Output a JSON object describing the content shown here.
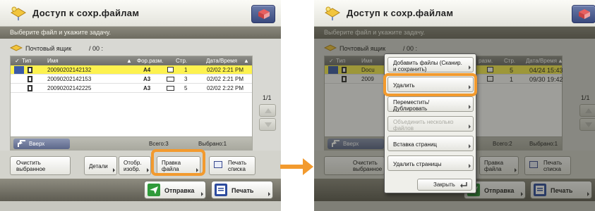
{
  "left": {
    "title": "Доступ к сохр.файлам",
    "instruction": "Выберите файл и укажите задачу.",
    "mailbox_label": "Почтовый ящик",
    "mailbox_count": "/ 00 :",
    "columns": {
      "type": "Тип",
      "name": "Имя",
      "size": "Фор.разм.",
      "pages": "Стр.",
      "datetime": "Дата/Время"
    },
    "rows": [
      {
        "name": "20090202142132",
        "size": "A4",
        "pages": "1",
        "datetime": "02/02 2:21 PM",
        "selected": true
      },
      {
        "name": "20090202142153",
        "size": "A3",
        "pages": "3",
        "datetime": "02/02 2:21 PM",
        "selected": false
      },
      {
        "name": "20090202142225",
        "size": "A3",
        "pages": "5",
        "datetime": "02/02 2:22 PM",
        "selected": false
      }
    ],
    "up_label": "Вверх",
    "total_label": "Всего:3",
    "selected_label": "Выбрано:1",
    "page_indicator": "1/1",
    "actions": {
      "clear": "Очистить выбранное",
      "details": "Детали",
      "show_image": "Отобр. изобр.",
      "edit_file": "Правка файла",
      "print_list": "Печать списка"
    },
    "send_label": "Отправка",
    "print_label": "Печать"
  },
  "right": {
    "title": "Доступ к сохр.файлам",
    "instruction": "Выберите файл и укажите задачу.",
    "mailbox_label": "Почтовый ящик",
    "mailbox_count": "/ 00 :",
    "columns": {
      "type": "Тип",
      "name": "Имя",
      "size": "разм.",
      "pages": "Стр.",
      "datetime": "Дата/Время"
    },
    "rows": [
      {
        "name": "Docu",
        "size": "",
        "pages": "5",
        "datetime": "04/24  15:43",
        "selected": true
      },
      {
        "name": "2009",
        "size": "",
        "pages": "1",
        "datetime": "09/30  19:42",
        "selected": false
      }
    ],
    "up_label": "Вверх",
    "total_label": "Всего:2",
    "selected_label": "Выбрано:1",
    "page_indicator": "1/1",
    "actions": {
      "clear": "Очистить выбранное",
      "edit_file": "Правка файла",
      "print_list": "Печать списка"
    },
    "send_label": "Отправка",
    "print_label": "Печать",
    "popup": {
      "items": [
        {
          "label": "Добавить файлы (Сканир. и сохранить)",
          "disabled": false
        },
        {
          "label": "Удалить",
          "disabled": false
        },
        {
          "label": "Переместить/ Дублировать",
          "disabled": false
        },
        {
          "label": "Объединить несколько файлов",
          "disabled": true
        },
        {
          "label": "Вставка страниц",
          "disabled": false
        },
        {
          "label": "Удалить страницы",
          "disabled": false
        }
      ],
      "close_label": "Закрыть"
    }
  },
  "colors": {
    "highlight": "#f29a2e",
    "selected_row": "#fdf24f",
    "header_band": "#6d6b60"
  }
}
